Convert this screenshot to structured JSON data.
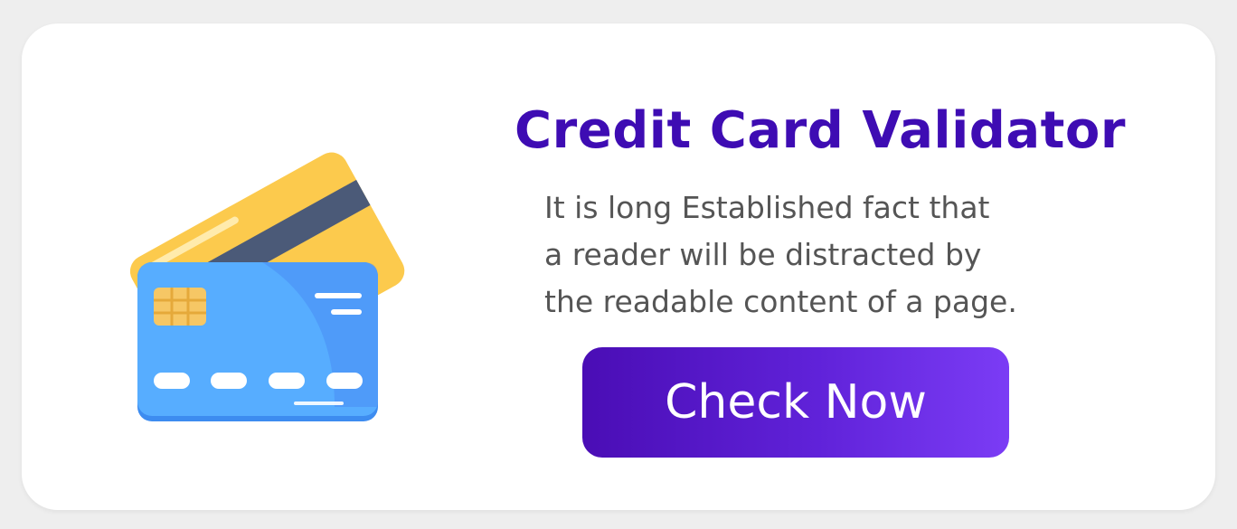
{
  "banner": {
    "title": "Credit Card Validator",
    "description_lines": [
      "It is long Established fact that",
      "a reader will be distracted by",
      "the readable content of a page."
    ],
    "button_label": "Check Now",
    "illustration_icon": "credit-cards-icon"
  },
  "colors": {
    "title": "#3e0cb3",
    "body_text": "#555555",
    "button_gradient_start": "#4a0db5",
    "button_gradient_end": "#7b3cf5",
    "back_card": "#fbc02d",
    "front_card": "#57adff",
    "chip": "#f6c765"
  }
}
